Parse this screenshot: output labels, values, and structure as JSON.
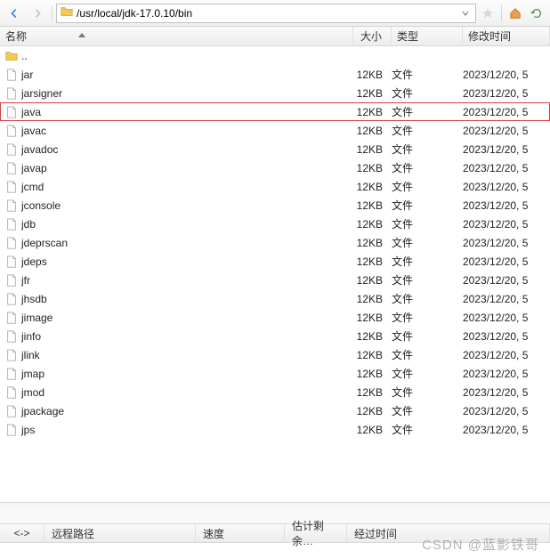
{
  "toolbar": {
    "path": "/usr/local/jdk-17.0.10/bin"
  },
  "columns": {
    "name": "名称",
    "size": "大小",
    "type": "类型",
    "date": "修改时间"
  },
  "parent_dir": "..",
  "files": [
    {
      "name": "jar",
      "size": "12KB",
      "type": "文件",
      "date": "2023/12/20, 5",
      "hl": false
    },
    {
      "name": "jarsigner",
      "size": "12KB",
      "type": "文件",
      "date": "2023/12/20, 5",
      "hl": false
    },
    {
      "name": "java",
      "size": "12KB",
      "type": "文件",
      "date": "2023/12/20, 5",
      "hl": true
    },
    {
      "name": "javac",
      "size": "12KB",
      "type": "文件",
      "date": "2023/12/20, 5",
      "hl": false
    },
    {
      "name": "javadoc",
      "size": "12KB",
      "type": "文件",
      "date": "2023/12/20, 5",
      "hl": false
    },
    {
      "name": "javap",
      "size": "12KB",
      "type": "文件",
      "date": "2023/12/20, 5",
      "hl": false
    },
    {
      "name": "jcmd",
      "size": "12KB",
      "type": "文件",
      "date": "2023/12/20, 5",
      "hl": false
    },
    {
      "name": "jconsole",
      "size": "12KB",
      "type": "文件",
      "date": "2023/12/20, 5",
      "hl": false
    },
    {
      "name": "jdb",
      "size": "12KB",
      "type": "文件",
      "date": "2023/12/20, 5",
      "hl": false
    },
    {
      "name": "jdeprscan",
      "size": "12KB",
      "type": "文件",
      "date": "2023/12/20, 5",
      "hl": false
    },
    {
      "name": "jdeps",
      "size": "12KB",
      "type": "文件",
      "date": "2023/12/20, 5",
      "hl": false
    },
    {
      "name": "jfr",
      "size": "12KB",
      "type": "文件",
      "date": "2023/12/20, 5",
      "hl": false
    },
    {
      "name": "jhsdb",
      "size": "12KB",
      "type": "文件",
      "date": "2023/12/20, 5",
      "hl": false
    },
    {
      "name": "jimage",
      "size": "12KB",
      "type": "文件",
      "date": "2023/12/20, 5",
      "hl": false
    },
    {
      "name": "jinfo",
      "size": "12KB",
      "type": "文件",
      "date": "2023/12/20, 5",
      "hl": false
    },
    {
      "name": "jlink",
      "size": "12KB",
      "type": "文件",
      "date": "2023/12/20, 5",
      "hl": false
    },
    {
      "name": "jmap",
      "size": "12KB",
      "type": "文件",
      "date": "2023/12/20, 5",
      "hl": false
    },
    {
      "name": "jmod",
      "size": "12KB",
      "type": "文件",
      "date": "2023/12/20, 5",
      "hl": false
    },
    {
      "name": "jpackage",
      "size": "12KB",
      "type": "文件",
      "date": "2023/12/20, 5",
      "hl": false
    },
    {
      "name": "jps",
      "size": "12KB",
      "type": "文件",
      "date": "2023/12/20, 5",
      "hl": false
    }
  ],
  "bottom": {
    "arrow": "<->",
    "remote": "远程路径",
    "speed": "速度",
    "eta": "估计剩余…",
    "elapsed": "经过时间"
  },
  "watermark": "CSDN @蓝影铁哥"
}
